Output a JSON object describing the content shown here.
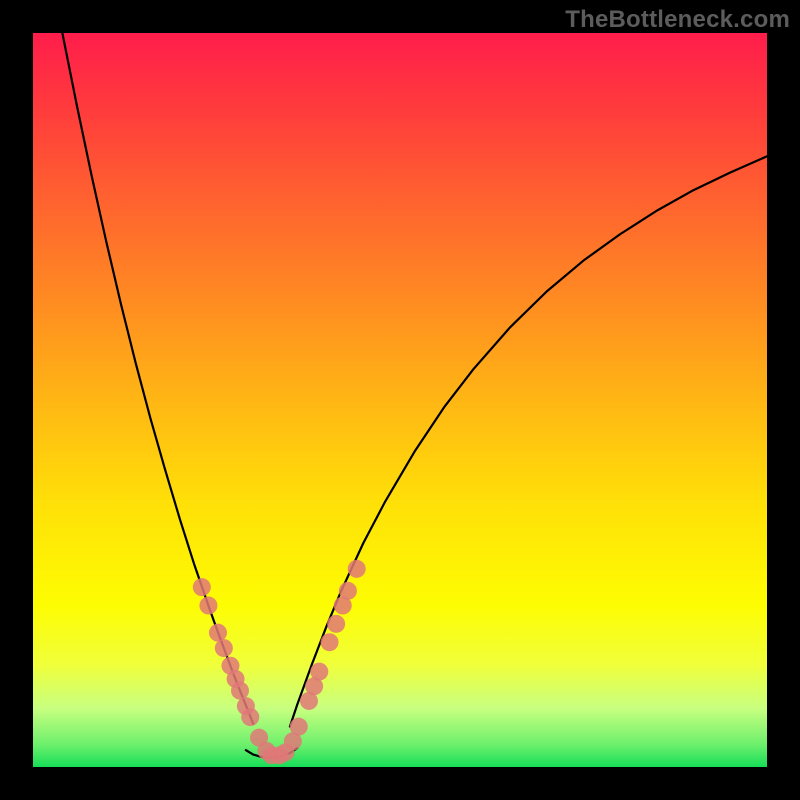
{
  "watermark": "TheBottleneck.com",
  "chart_data": {
    "type": "line",
    "title": "",
    "xlabel": "",
    "ylabel": "",
    "xlim": [
      0,
      100
    ],
    "ylim": [
      0,
      100
    ],
    "series": [
      {
        "name": "left-curve",
        "x": [
          4,
          6,
          8,
          10,
          12,
          14,
          16,
          18,
          20,
          22,
          24,
          25,
          26,
          27,
          28,
          29,
          30
        ],
        "values": [
          100,
          90,
          80.5,
          71.5,
          63,
          55,
          47.5,
          40.5,
          33.8,
          27.5,
          21.7,
          18.9,
          16.2,
          13.5,
          10.9,
          8.4,
          5.9
        ],
        "color": "#000000"
      },
      {
        "name": "right-curve",
        "x": [
          35,
          36,
          38,
          40,
          42,
          45,
          48,
          52,
          56,
          60,
          65,
          70,
          75,
          80,
          85,
          90,
          95,
          100
        ],
        "values": [
          5.5,
          8.5,
          14.0,
          19.2,
          24.0,
          30.5,
          36.2,
          43.0,
          49.0,
          54.2,
          59.9,
          64.8,
          69.0,
          72.6,
          75.8,
          78.6,
          81.0,
          83.2
        ],
        "color": "#000000"
      },
      {
        "name": "trough-floor",
        "x": [
          29,
          30,
          31,
          32,
          33,
          34,
          35,
          36
        ],
        "values": [
          2.3,
          1.7,
          1.4,
          1.3,
          1.3,
          1.5,
          1.9,
          2.6
        ],
        "color": "#000000"
      }
    ],
    "markers": {
      "name": "highlight-dots",
      "color": "#e07878",
      "radius_px": 9,
      "points": [
        {
          "x": 23.0,
          "y": 24.5
        },
        {
          "x": 23.9,
          "y": 22.0
        },
        {
          "x": 25.2,
          "y": 18.3
        },
        {
          "x": 26.0,
          "y": 16.2
        },
        {
          "x": 26.9,
          "y": 13.8
        },
        {
          "x": 27.6,
          "y": 12.0
        },
        {
          "x": 28.2,
          "y": 10.4
        },
        {
          "x": 29.0,
          "y": 8.3
        },
        {
          "x": 29.6,
          "y": 6.8
        },
        {
          "x": 30.8,
          "y": 4.0
        },
        {
          "x": 31.8,
          "y": 2.2
        },
        {
          "x": 32.5,
          "y": 1.6
        },
        {
          "x": 33.6,
          "y": 1.6
        },
        {
          "x": 34.4,
          "y": 2.0
        },
        {
          "x": 35.4,
          "y": 3.5
        },
        {
          "x": 36.2,
          "y": 5.5
        },
        {
          "x": 37.6,
          "y": 9.0
        },
        {
          "x": 38.3,
          "y": 11.0
        },
        {
          "x": 39.0,
          "y": 13.0
        },
        {
          "x": 40.4,
          "y": 17.0
        },
        {
          "x": 41.3,
          "y": 19.5
        },
        {
          "x": 42.2,
          "y": 22.0
        },
        {
          "x": 42.9,
          "y": 24.0
        },
        {
          "x": 44.1,
          "y": 27.0
        }
      ]
    }
  }
}
